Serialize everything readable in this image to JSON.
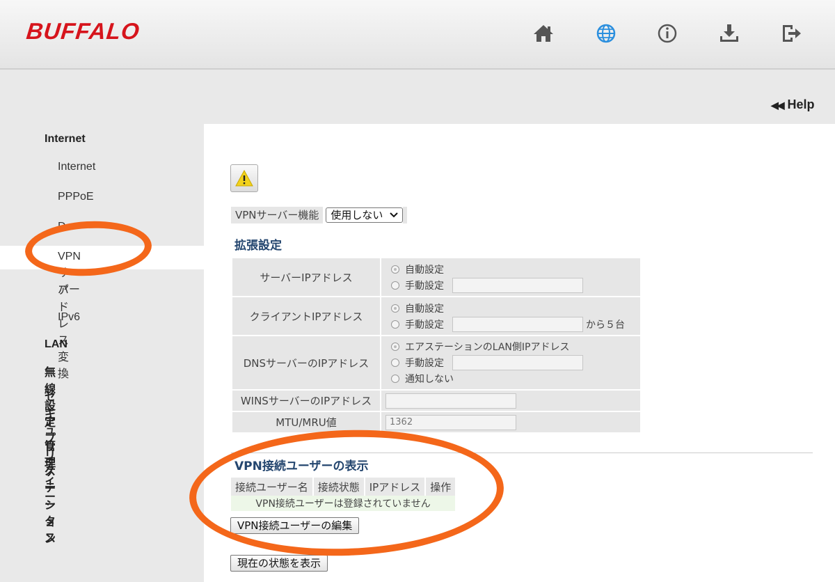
{
  "header": {
    "logo": "BUFFALO",
    "icons": [
      "home-icon",
      "globe-icon",
      "info-icon",
      "download-icon",
      "logout-icon"
    ],
    "colors": {
      "logo": "#d6141c",
      "globe": "#2b8fde",
      "icons": "#555555"
    }
  },
  "help": {
    "arrows": "◀◀",
    "label": "Help"
  },
  "sidebar": {
    "internet_category": "Internet",
    "items": [
      {
        "label": "Internet"
      },
      {
        "label": "PPPoE"
      },
      {
        "label": "D"
      },
      {
        "label": "VPNサーバー",
        "active": true
      },
      {
        "label": "アドレス変換"
      },
      {
        "label": "IPv6"
      }
    ],
    "categories": [
      "LAN",
      "無線設定",
      "セキュリティー",
      "アプリケーション",
      "管理",
      "ステータス"
    ]
  },
  "main": {
    "vpn_function": {
      "label": "VPNサーバー機能",
      "selected": "使用しない"
    },
    "extended_title": "拡張設定",
    "server_ip": {
      "label": "サーバーIPアドレス",
      "option_auto": "自動設定",
      "option_manual": "手動設定"
    },
    "client_ip": {
      "label": "クライアントIPアドレス",
      "option_auto": "自動設定",
      "option_manual": "手動設定",
      "suffix": "から５台"
    },
    "dns": {
      "label": "DNSサーバーのIPアドレス",
      "option_lan": "エアステーションのLAN側IPアドレス",
      "option_manual": "手動設定",
      "option_none": "通知しない"
    },
    "wins": {
      "label": "WINSサーバーのIPアドレス",
      "value": ""
    },
    "mtu": {
      "label": "MTU/MRU値",
      "value": "1362"
    },
    "users_title": "VPN接続ユーザーの表示",
    "users_table": {
      "headers": [
        "接続ユーザー名",
        "接続状態",
        "IPアドレス",
        "操作"
      ],
      "empty_message": "VPN接続ユーザーは登録されていません"
    },
    "edit_users_button": "VPN接続ユーザーの編集",
    "status_button": "現在の状態を表示"
  },
  "annotation_color": "#f4671a"
}
